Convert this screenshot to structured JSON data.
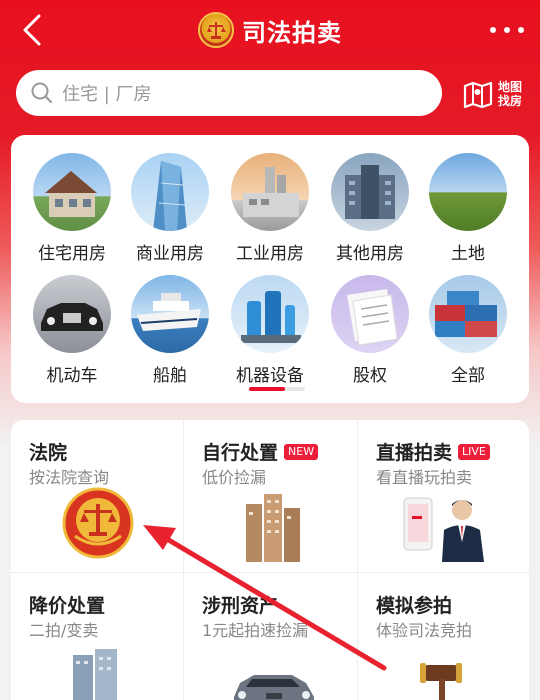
{
  "header": {
    "title": "司法拍卖",
    "back_icon": "back-chevron-icon",
    "more_icon": "more-dots-icon",
    "logo_icon": "court-emblem-icon"
  },
  "search": {
    "placeholder": "住宅 | 厂房",
    "map_label_line1": "地图",
    "map_label_line2": "找房"
  },
  "categories": [
    {
      "label": "住宅用房",
      "icon": "house-photo"
    },
    {
      "label": "商业用房",
      "icon": "office-tower-photo"
    },
    {
      "label": "工业用房",
      "icon": "factory-photo"
    },
    {
      "label": "其他用房",
      "icon": "building-photo"
    },
    {
      "label": "土地",
      "icon": "land-photo"
    },
    {
      "label": "机动车",
      "icon": "car-photo"
    },
    {
      "label": "船舶",
      "icon": "ship-photo"
    },
    {
      "label": "机器设备",
      "icon": "machinery-photo"
    },
    {
      "label": "股权",
      "icon": "documents-photo"
    },
    {
      "label": "全部",
      "icon": "containers-photo"
    }
  ],
  "grid": [
    {
      "title": "法院",
      "subtitle": "按法院查询",
      "badge": ""
    },
    {
      "title": "自行处置",
      "subtitle": "低价捡漏",
      "badge": "NEW"
    },
    {
      "title": "直播拍卖",
      "subtitle": "看直播玩拍卖",
      "badge": "LIVE"
    },
    {
      "title": "降价处置",
      "subtitle": "二拍/变卖",
      "badge": ""
    },
    {
      "title": "涉刑资产",
      "subtitle": "1元起拍速捡漏",
      "badge": ""
    },
    {
      "title": "模拟参拍",
      "subtitle": "体验司法竞拍",
      "badge": ""
    }
  ],
  "colors": {
    "brand_red": "#e8101f",
    "badge_red": "#ec1e3a",
    "arrow_red": "#e8222e"
  }
}
